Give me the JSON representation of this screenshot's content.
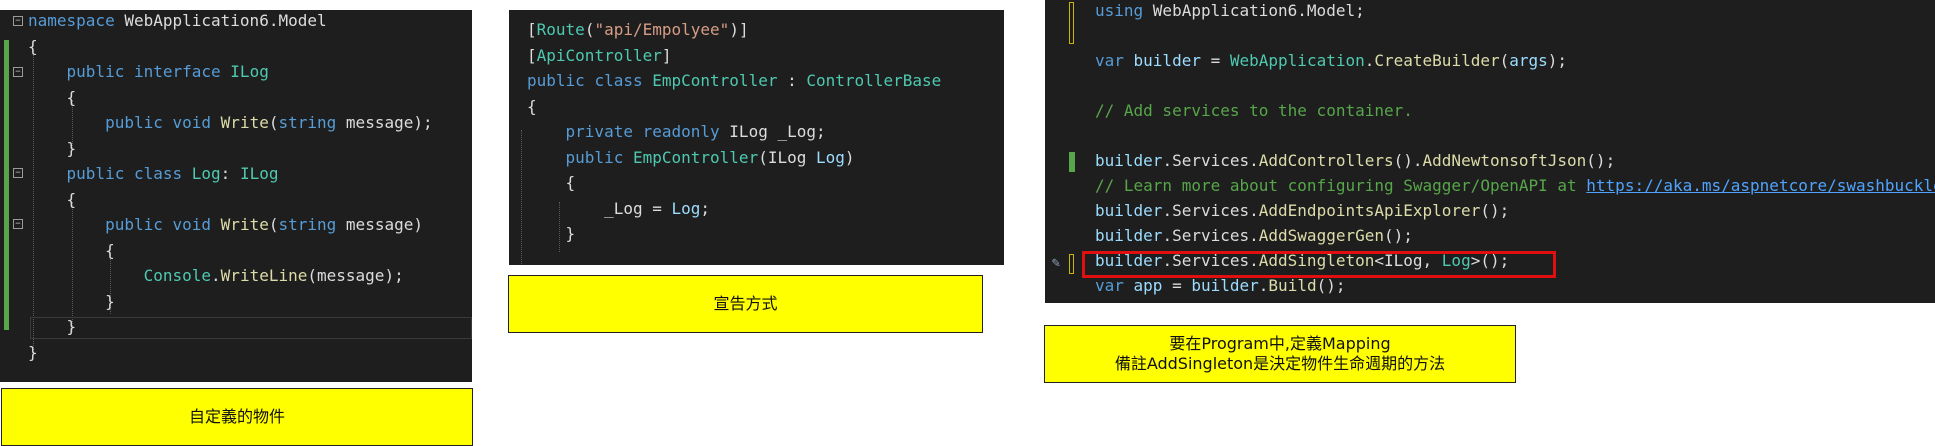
{
  "panel1": {
    "lines": [
      [
        {
          "t": "namespace ",
          "c": "kw"
        },
        {
          "t": "WebApplication6.Model",
          "c": ""
        }
      ],
      [
        {
          "t": "{",
          "c": ""
        }
      ],
      [
        {
          "t": "    public ",
          "c": "kw"
        },
        {
          "t": "interface ",
          "c": "kw"
        },
        {
          "t": "ILog",
          "c": "ty"
        }
      ],
      [
        {
          "t": "    {",
          "c": ""
        }
      ],
      [
        {
          "t": "        public ",
          "c": "kw"
        },
        {
          "t": "void ",
          "c": "kw"
        },
        {
          "t": "Write",
          "c": "fn"
        },
        {
          "t": "(",
          "c": ""
        },
        {
          "t": "string ",
          "c": "kw"
        },
        {
          "t": "message);",
          "c": ""
        }
      ],
      [
        {
          "t": "    }",
          "c": ""
        }
      ],
      [
        {
          "t": "    public ",
          "c": "kw"
        },
        {
          "t": "class ",
          "c": "kw"
        },
        {
          "t": "Log",
          "c": "ty"
        },
        {
          "t": ": ",
          "c": ""
        },
        {
          "t": "ILog",
          "c": "ty"
        }
      ],
      [
        {
          "t": "    {",
          "c": ""
        }
      ],
      [
        {
          "t": "        public ",
          "c": "kw"
        },
        {
          "t": "void ",
          "c": "kw"
        },
        {
          "t": "Write",
          "c": "fn"
        },
        {
          "t": "(",
          "c": ""
        },
        {
          "t": "string ",
          "c": "kw"
        },
        {
          "t": "message)",
          "c": ""
        }
      ],
      [
        {
          "t": "        {",
          "c": ""
        }
      ],
      [
        {
          "t": "            ",
          "c": ""
        },
        {
          "t": "Console",
          "c": "ty"
        },
        {
          "t": ".",
          "c": ""
        },
        {
          "t": "WriteLine",
          "c": "fn"
        },
        {
          "t": "(message);",
          "c": ""
        }
      ],
      [
        {
          "t": "        }",
          "c": ""
        }
      ],
      [
        {
          "t": "    }",
          "c": ""
        }
      ],
      [
        {
          "t": "}",
          "c": ""
        }
      ]
    ],
    "caption": "自定義的物件"
  },
  "panel2": {
    "lines": [
      [
        {
          "t": "[",
          "c": ""
        },
        {
          "t": "Route",
          "c": "ty"
        },
        {
          "t": "(",
          "c": ""
        },
        {
          "t": "\"api/Empolyee\"",
          "c": "st"
        },
        {
          "t": ")]",
          "c": ""
        }
      ],
      [
        {
          "t": "[",
          "c": ""
        },
        {
          "t": "ApiController",
          "c": "ty"
        },
        {
          "t": "]",
          "c": ""
        }
      ],
      [
        {
          "t": "public ",
          "c": "kw"
        },
        {
          "t": "class ",
          "c": "kw"
        },
        {
          "t": "EmpController",
          "c": "ty"
        },
        {
          "t": " : ",
          "c": ""
        },
        {
          "t": "ControllerBase",
          "c": "ty"
        }
      ],
      [
        {
          "t": "{",
          "c": ""
        }
      ],
      [
        {
          "t": "    private ",
          "c": "kw"
        },
        {
          "t": "readonly ",
          "c": "kw"
        },
        {
          "t": "ILog ",
          "c": ""
        },
        {
          "t": "_Log;",
          "c": ""
        }
      ],
      [
        {
          "t": "    public ",
          "c": "kw"
        },
        {
          "t": "EmpController",
          "c": "ty"
        },
        {
          "t": "(ILog ",
          "c": ""
        },
        {
          "t": "Log",
          "c": "pr"
        },
        {
          "t": ")",
          "c": ""
        }
      ],
      [
        {
          "t": "    {",
          "c": ""
        }
      ],
      [
        {
          "t": "        _Log = ",
          "c": ""
        },
        {
          "t": "Log",
          "c": "pr"
        },
        {
          "t": ";",
          "c": ""
        }
      ],
      [
        {
          "t": "    }",
          "c": ""
        }
      ]
    ],
    "caption": "宣告方式"
  },
  "panel3": {
    "lines": [
      [
        {
          "t": "using ",
          "c": "kw"
        },
        {
          "t": "WebApplication6.Model;",
          "c": ""
        }
      ],
      [
        {
          "t": "",
          "c": ""
        }
      ],
      [
        {
          "t": "var ",
          "c": "kw"
        },
        {
          "t": "builder",
          "c": "pr"
        },
        {
          "t": " = ",
          "c": ""
        },
        {
          "t": "WebApplication",
          "c": "ty"
        },
        {
          "t": ".",
          "c": ""
        },
        {
          "t": "CreateBuilder",
          "c": "fn"
        },
        {
          "t": "(",
          "c": ""
        },
        {
          "t": "args",
          "c": "pr"
        },
        {
          "t": ");",
          "c": ""
        }
      ],
      [
        {
          "t": "",
          "c": ""
        }
      ],
      [
        {
          "t": "// Add services to the container.",
          "c": "cm"
        }
      ],
      [
        {
          "t": "",
          "c": ""
        }
      ],
      [
        {
          "t": "builder",
          "c": "pr"
        },
        {
          "t": ".Services.",
          "c": ""
        },
        {
          "t": "AddControllers",
          "c": "fn"
        },
        {
          "t": "().",
          "c": ""
        },
        {
          "t": "AddNewtonsoftJson",
          "c": "fn"
        },
        {
          "t": "();",
          "c": ""
        }
      ],
      [
        {
          "t": "// Learn more about configuring Swagger/OpenAPI at ",
          "c": "cm"
        },
        {
          "t": "https://aka.ms/aspnetcore/swashbuckle",
          "c": "lk"
        }
      ],
      [
        {
          "t": "builder",
          "c": "pr"
        },
        {
          "t": ".Services.",
          "c": ""
        },
        {
          "t": "AddEndpointsApiExplorer",
          "c": "fn"
        },
        {
          "t": "();",
          "c": ""
        }
      ],
      [
        {
          "t": "builder",
          "c": "pr"
        },
        {
          "t": ".Services.",
          "c": ""
        },
        {
          "t": "AddSwaggerGen",
          "c": "fn"
        },
        {
          "t": "();",
          "c": ""
        }
      ],
      [
        {
          "t": "builder",
          "c": "pr"
        },
        {
          "t": ".Services.",
          "c": ""
        },
        {
          "t": "AddSingleton",
          "c": "fn"
        },
        {
          "t": "<ILog, ",
          "c": ""
        },
        {
          "t": "Log",
          "c": "ty"
        },
        {
          "t": ">();",
          "c": ""
        }
      ],
      [
        {
          "t": "var ",
          "c": "kw"
        },
        {
          "t": "app",
          "c": "pr"
        },
        {
          "t": " = ",
          "c": ""
        },
        {
          "t": "builder",
          "c": "pr"
        },
        {
          "t": ".",
          "c": ""
        },
        {
          "t": "Build",
          "c": "fn"
        },
        {
          "t": "();",
          "c": ""
        }
      ]
    ],
    "caption_line1": "要在Program中,定義Mapping",
    "caption_line2": "備註AddSingleton是決定物件生命週期的方法"
  }
}
